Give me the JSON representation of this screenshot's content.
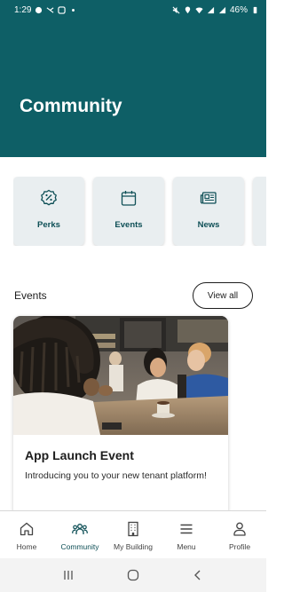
{
  "status_bar": {
    "time": "1:29",
    "battery": "46%"
  },
  "header": {
    "title": "Community",
    "bg_color": "#0e5f66"
  },
  "quick_links": [
    {
      "label": "Perks",
      "icon": "percent-badge-icon"
    },
    {
      "label": "Events",
      "icon": "calendar-icon"
    },
    {
      "label": "News",
      "icon": "newspaper-icon"
    },
    {
      "label": "",
      "icon": ""
    }
  ],
  "events_section": {
    "title": "Events",
    "view_all_label": "View all",
    "card": {
      "title": "App Launch Event",
      "description": "Introducing you to your new tenant platform!",
      "image": "cafe-people-photo"
    }
  },
  "bottom_nav": [
    {
      "label": "Home",
      "icon": "home-icon",
      "active": false
    },
    {
      "label": "Community",
      "icon": "community-icon",
      "active": true
    },
    {
      "label": "My Building",
      "icon": "building-icon",
      "active": false
    },
    {
      "label": "Menu",
      "icon": "menu-icon",
      "active": false
    },
    {
      "label": "Profile",
      "icon": "profile-icon",
      "active": false
    }
  ],
  "system_nav": [
    "recent-apps-icon",
    "home-circle-icon",
    "back-icon"
  ]
}
